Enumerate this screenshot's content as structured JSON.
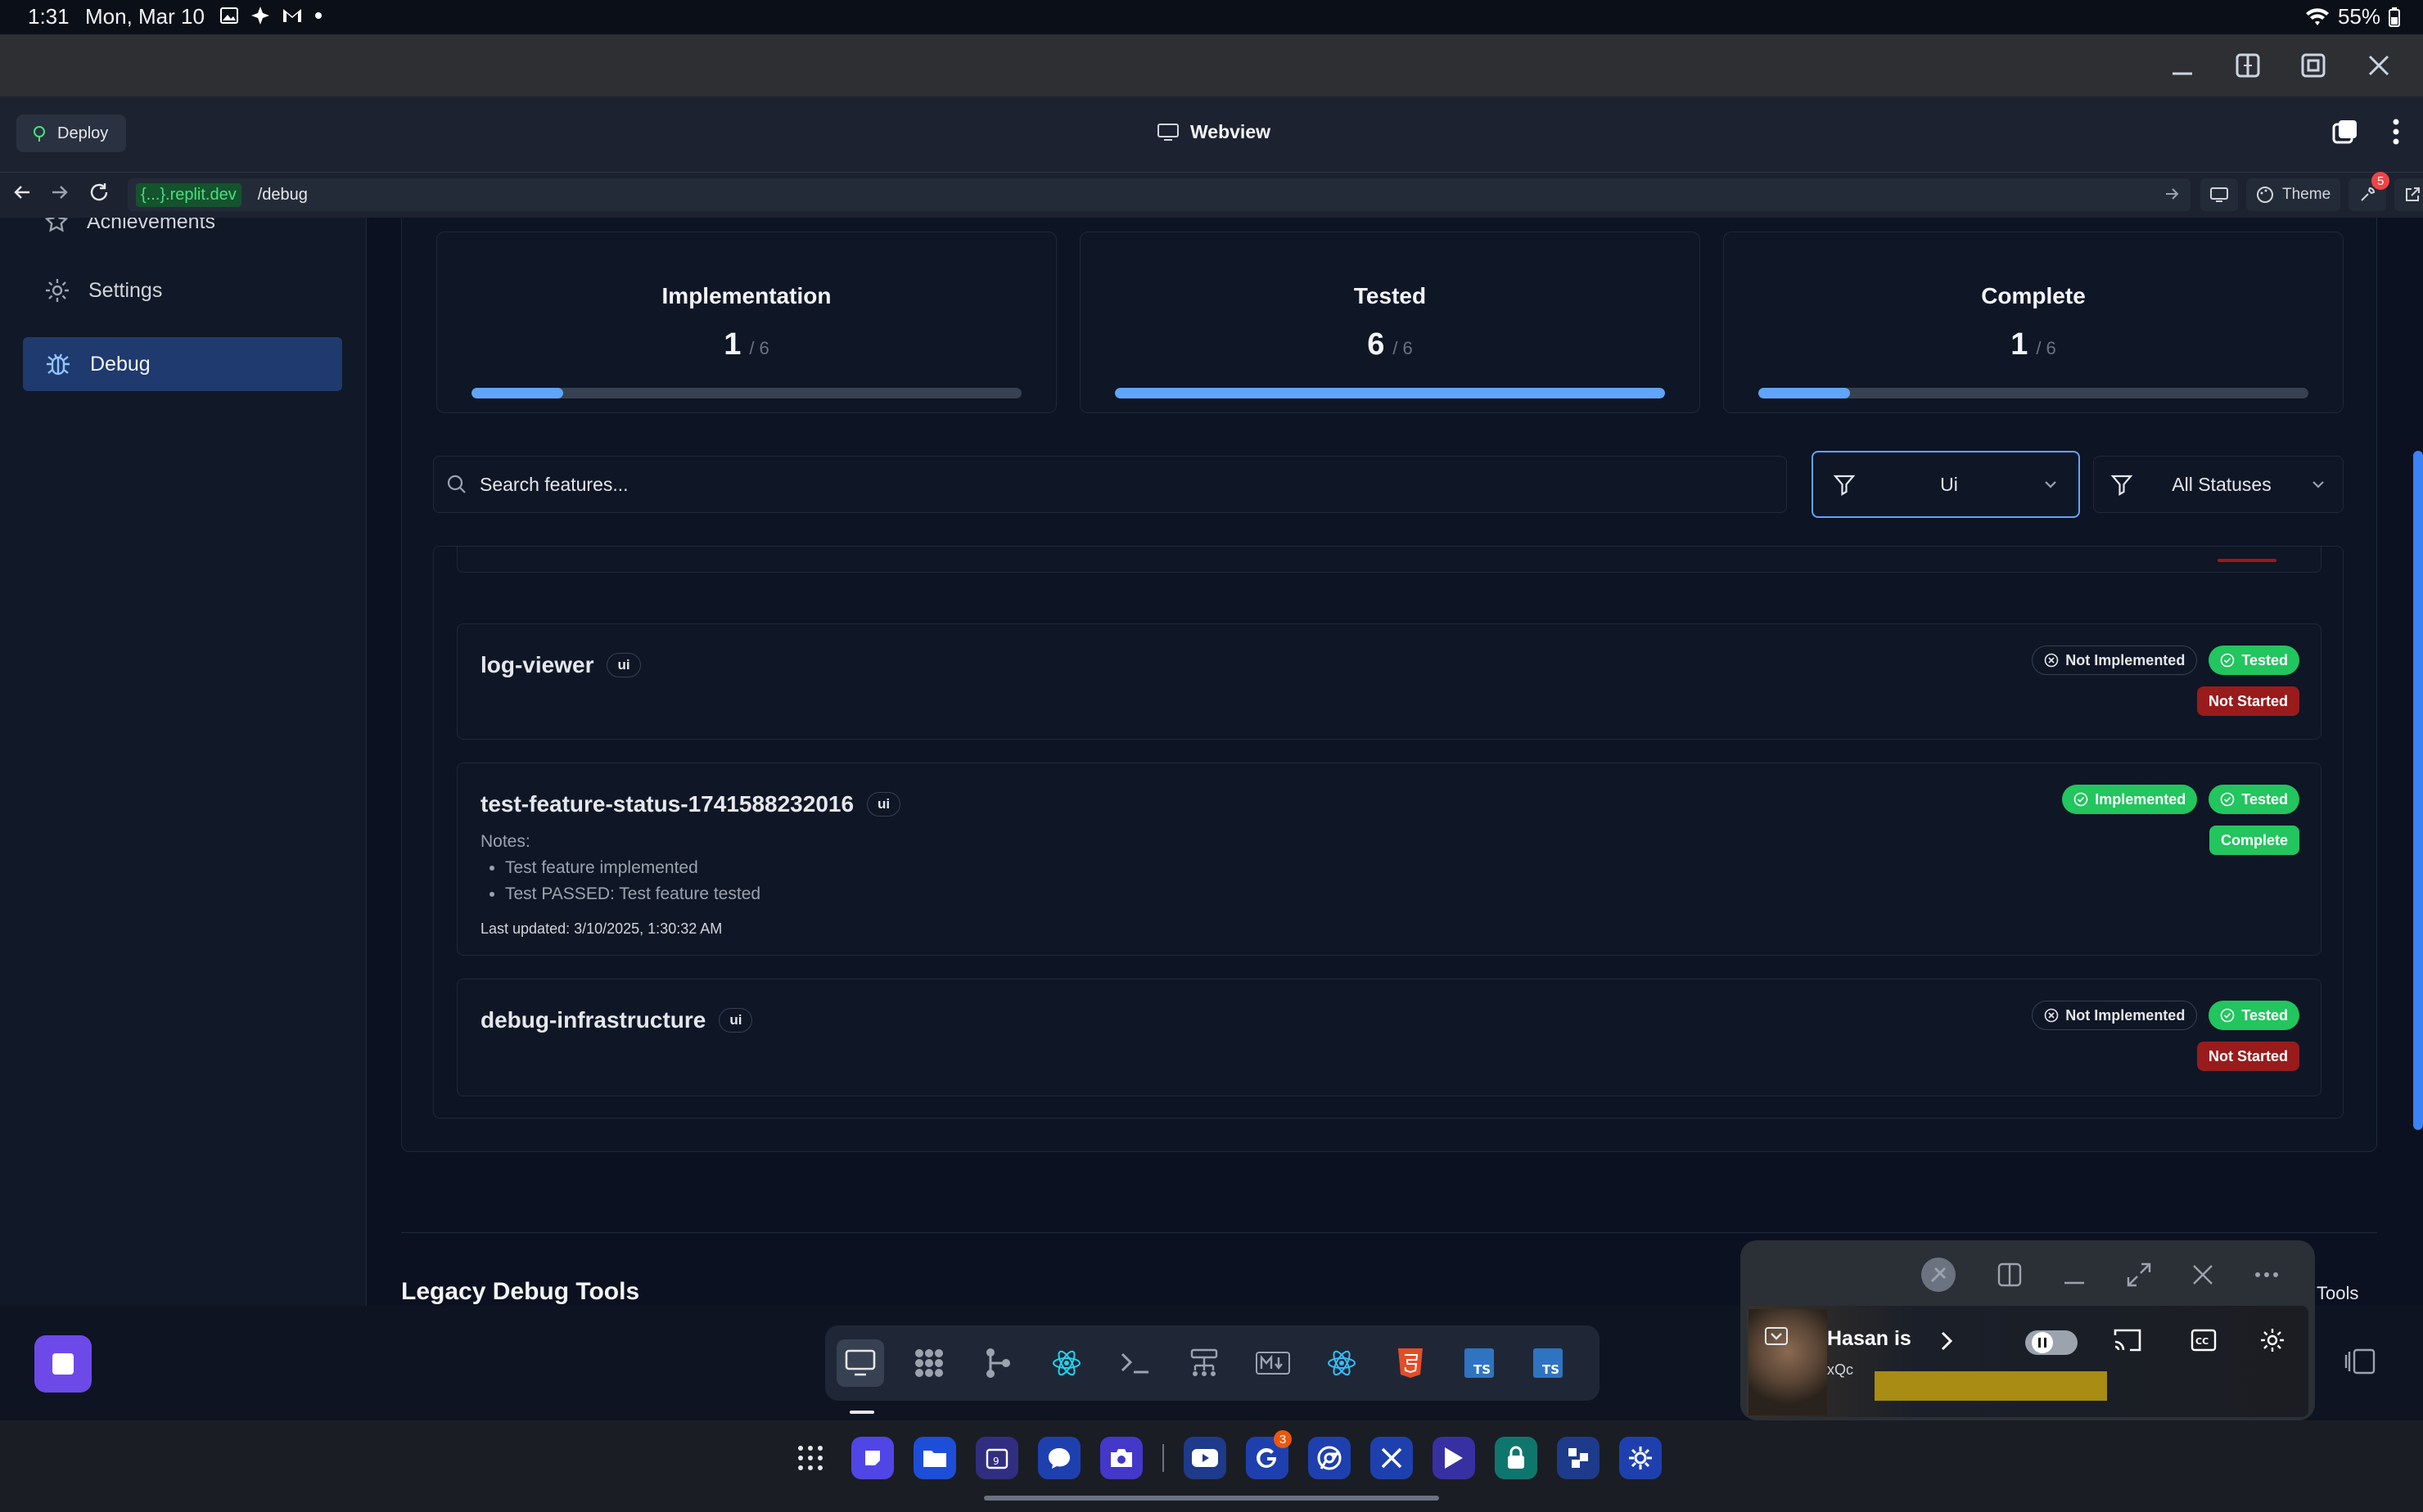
{
  "status_bar": {
    "time": "1:31",
    "date": "Mon, Mar 10",
    "battery": "55%"
  },
  "replit": {
    "deploy_label": "Deploy",
    "webview_label": "Webview",
    "url_host": "{...}.replit.dev",
    "url_path": "/debug",
    "theme_label": "Theme",
    "notif_count": "5"
  },
  "sidebar": {
    "items": [
      {
        "label": "Achievements",
        "icon": "star-icon"
      },
      {
        "label": "Settings",
        "icon": "gear-icon"
      },
      {
        "label": "Debug",
        "icon": "bug-icon"
      }
    ]
  },
  "stats": [
    {
      "title": "Implementation",
      "value": "1",
      "total": "/ 6",
      "progress": 0.1667
    },
    {
      "title": "Tested",
      "value": "6",
      "total": "/ 6",
      "progress": 1.0
    },
    {
      "title": "Complete",
      "value": "1",
      "total": "/ 6",
      "progress": 0.1667
    }
  ],
  "search": {
    "placeholder": "Search features..."
  },
  "filters": {
    "category": "Ui",
    "status": "All Statuses"
  },
  "features": [
    {
      "name": "log-viewer",
      "tag": "ui",
      "impl": "Not Implemented",
      "tested": "Tested",
      "state": "Not Started"
    },
    {
      "name": "test-feature-status-1741588232016",
      "tag": "ui",
      "impl": "Implemented",
      "tested": "Tested",
      "state": "Complete",
      "notes_label": "Notes:",
      "notes": [
        "Test feature implemented",
        "Test PASSED: Test feature tested"
      ],
      "updated": "Last updated: 3/10/2025, 1:30:32 AM"
    },
    {
      "name": "debug-infrastructure",
      "tag": "ui",
      "impl": "Not Implemented",
      "tested": "Tested",
      "state": "Not Started"
    }
  ],
  "legacy": {
    "title": "Legacy Debug Tools",
    "tools_label": "Tools"
  },
  "pip": {
    "title": "Hasan is",
    "subtitle": "xQc"
  },
  "nav_badge": "3",
  "colors": {
    "accent": "#60a5fa",
    "green": "#22c55e",
    "red": "#991b1b",
    "sidebar_active": "#1e3a6e"
  }
}
